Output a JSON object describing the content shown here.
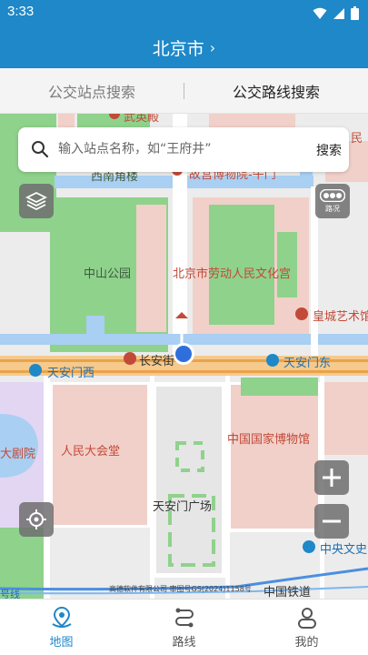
{
  "status_bar": {
    "time": "3:33"
  },
  "header": {
    "title": "北京市",
    "chevron": "›"
  },
  "tabs": [
    {
      "label": "公交站点搜索",
      "active": false
    },
    {
      "label": "公交路线搜索",
      "active": true
    }
  ],
  "search": {
    "placeholder": "输入站点名称，如“王府井”",
    "button_label": "搜索"
  },
  "map": {
    "labels": {
      "wudian": "武英殿",
      "xinanjiaolou": "西南角楼",
      "min": "民",
      "gate": "故宫博物院-午门",
      "zhongshan": "中山公园",
      "laodong": "北京市劳动人民文化宫",
      "huangcheng": "皇城艺术馆",
      "changan": "长安街",
      "tiananmen_west": "天安门西",
      "tiananmen_east": "天安门东",
      "theater": "大剧院",
      "great_hall": "人民大会堂",
      "museum": "中国国家博物馆",
      "square": "天安门广场",
      "central_culture": "中央文史",
      "railway": "中国铁道",
      "line1": "号线"
    },
    "traffic_label": "路况",
    "copyright": "高德软件有限公司 审图号GS(2024)1158号"
  },
  "icons": {
    "search": "search-icon",
    "layers": "layers-icon",
    "traffic": "traffic-icon",
    "locate": "locate-icon",
    "zoom_in": "plus-icon",
    "zoom_out": "minus-icon",
    "nav_map": "map-pin-icon",
    "nav_route": "route-icon",
    "nav_mine": "user-icon"
  },
  "nav": [
    {
      "label": "地图",
      "active": true
    },
    {
      "label": "路线",
      "active": false
    },
    {
      "label": "我的",
      "active": false
    }
  ],
  "colors": {
    "primary": "#1e88c8",
    "park_green": "#8fd28c",
    "building_pink": "#f1d0c9",
    "road_orange": "#e8a34a",
    "poi_red": "#c24a38",
    "location_blue": "#2f6fdb"
  }
}
